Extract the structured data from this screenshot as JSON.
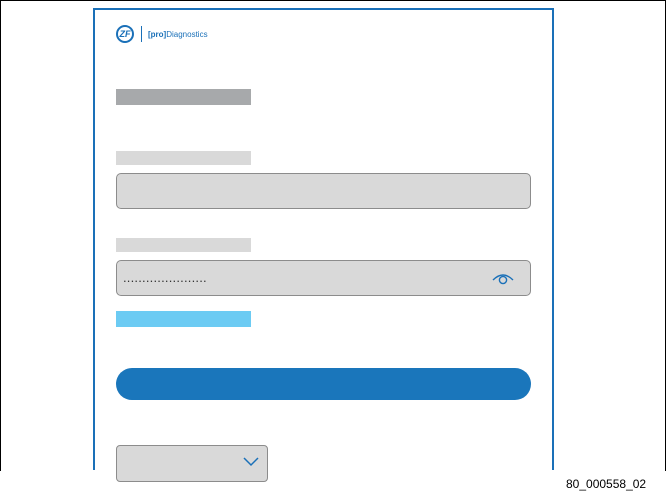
{
  "logo": {
    "mark": "ZF",
    "bracket_text": "[pro]",
    "product_text": "Diagnostics"
  },
  "password": {
    "masked_value": "......................"
  },
  "figure_id": "80_000558_02",
  "colors": {
    "brand_blue": "#1a70b8",
    "button_blue": "#1a76bb",
    "link_blue": "#6ccbf3",
    "field_gray": "#d9d9d9",
    "title_gray": "#a7a9ab"
  },
  "icons": {
    "password_toggle": "eye-icon",
    "language_dropdown": "chevron-down-icon"
  }
}
